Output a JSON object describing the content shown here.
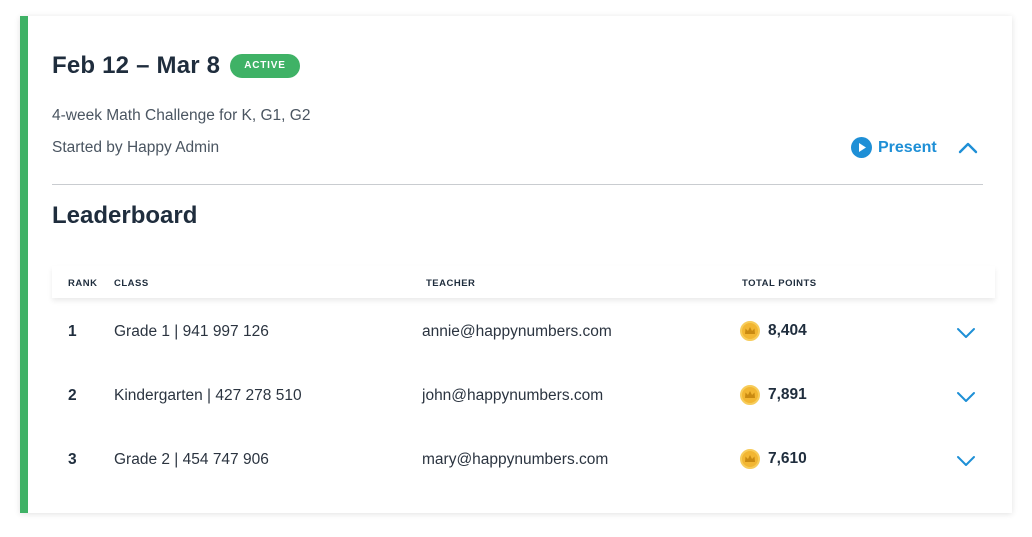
{
  "challenge": {
    "date_range": "Feb 12 – Mar 8",
    "status": "ACTIVE",
    "description": "4-week Math Challenge for K, G1, G2",
    "started_by": "Started by Happy Admin",
    "present_label": "Present"
  },
  "leaderboard": {
    "title": "Leaderboard",
    "columns": {
      "rank": "RANK",
      "class": "CLASS",
      "teacher": "TEACHER",
      "points": "TOTAL POINTS"
    },
    "rows": [
      {
        "rank": "1",
        "class": "Grade 1 | 941 997 126",
        "teacher": "annie@happynumbers.com",
        "points": "8,404"
      },
      {
        "rank": "2",
        "class": "Kindergarten | 427 278 510",
        "teacher": "john@happynumbers.com",
        "points": "7,891"
      },
      {
        "rank": "3",
        "class": "Grade 2 | 454 747 906",
        "teacher": "mary@happynumbers.com",
        "points": "7,610"
      }
    ]
  },
  "colors": {
    "accent_green": "#3fb266",
    "link_blue": "#1e8fd6",
    "coin_gold": "#f2b632"
  },
  "icons": {
    "present": "play-circle-icon",
    "collapse": "chevron-up-icon",
    "expand": "chevron-down-icon",
    "coin": "crown-coin-icon"
  }
}
